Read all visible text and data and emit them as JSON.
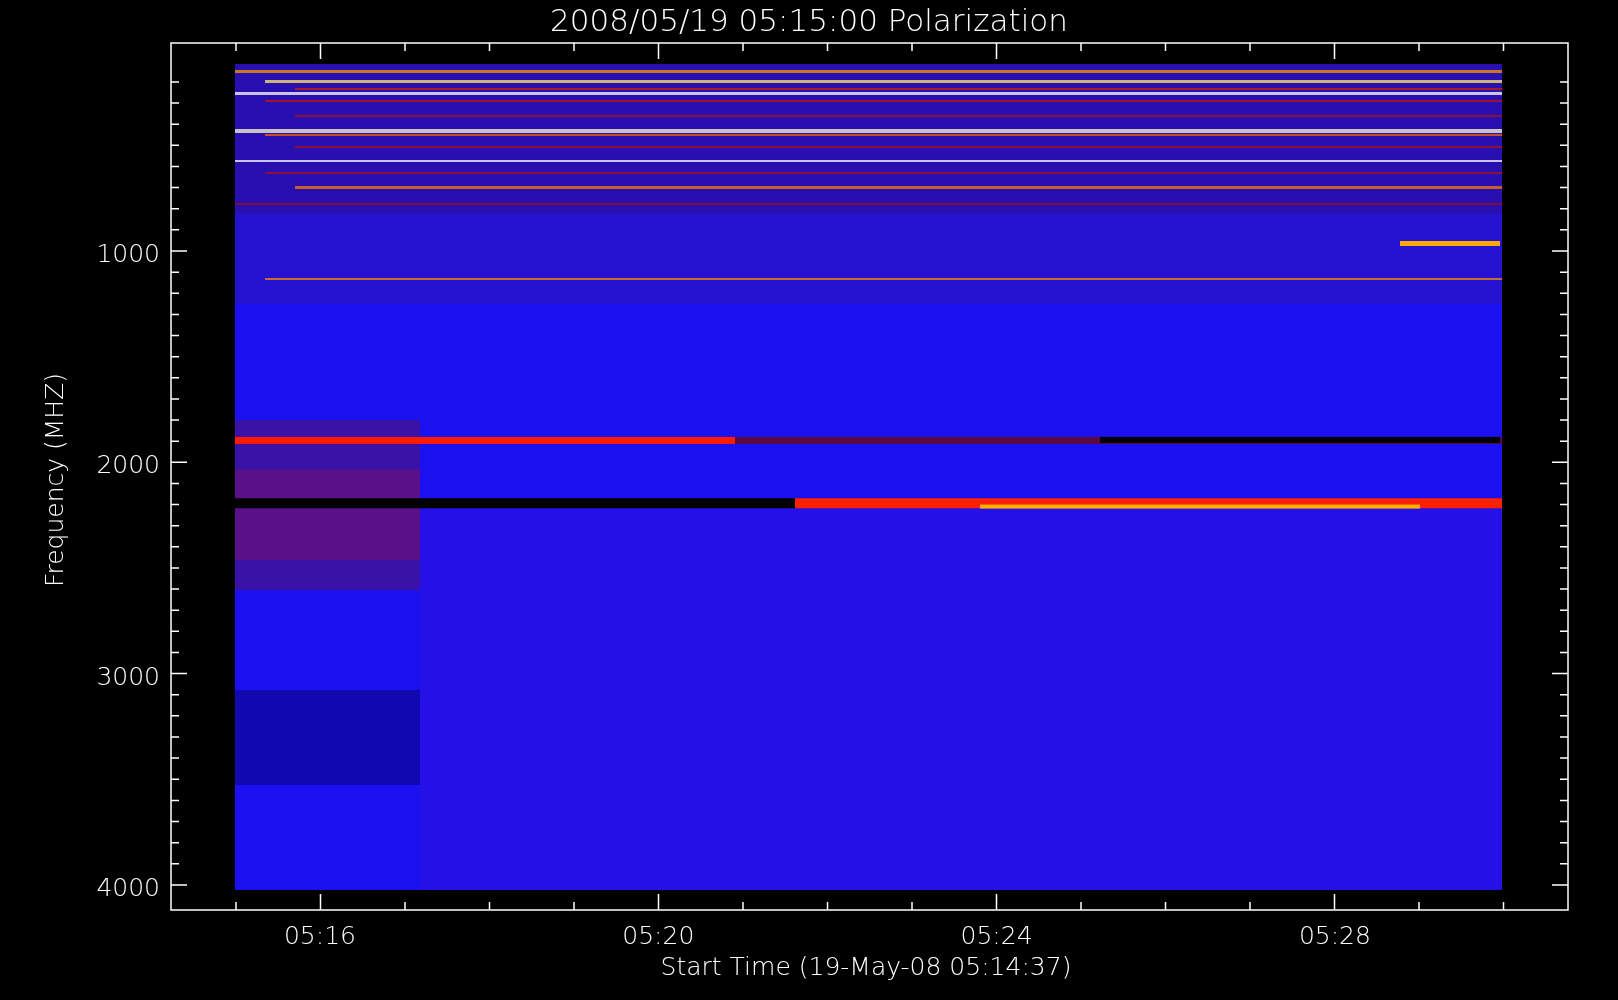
{
  "title": "2008/05/19 05:15:00 Polarization",
  "y_axis": {
    "label": "Frequency (MHZ)",
    "ticks": [
      "1000",
      "2000",
      "3000",
      "4000"
    ]
  },
  "x_axis": {
    "label": "Start Time (19-May-08 05:14:37)",
    "ticks": [
      "05:16",
      "05:20",
      "05:24",
      "05:28"
    ]
  }
}
